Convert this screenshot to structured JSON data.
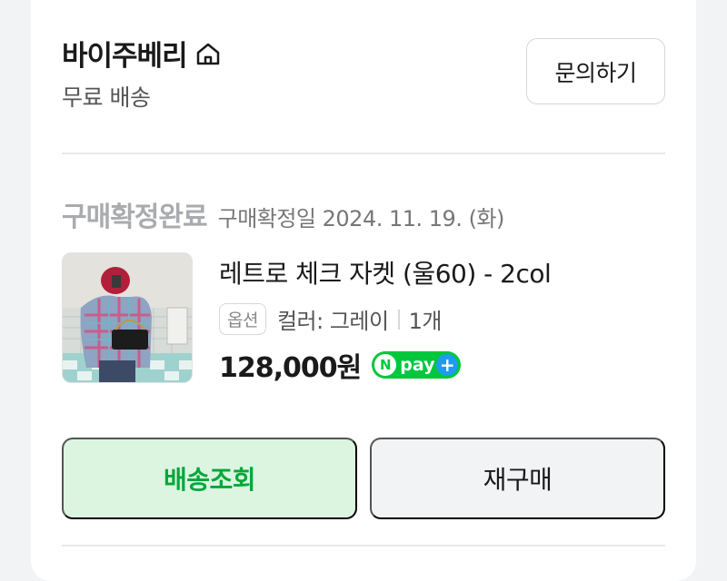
{
  "store": {
    "name": "바이주베리",
    "shipping": "무료 배송"
  },
  "actions": {
    "inquiry_label": "문의하기",
    "track_label": "배송조회",
    "rebuy_label": "재구매"
  },
  "order": {
    "status": "구매확정완료",
    "confirm_date": "구매확정일 2024. 11. 19. (화)",
    "product_name": "레트로 체크 자켓 (울60) - 2col",
    "option_badge": "옵션",
    "option_text": "컬러: 그레이",
    "quantity": "1개",
    "price": "128,000원"
  },
  "npay": {
    "n": "N",
    "text": "pay",
    "plus": "+"
  },
  "icons": {
    "home": "home-icon",
    "product": "product-thumbnail"
  },
  "colors": {
    "accent_green": "#05a83a",
    "track_bg": "#dcf5e1",
    "npay_green": "#00c73c",
    "npay_blue": "#1e9bf0"
  }
}
